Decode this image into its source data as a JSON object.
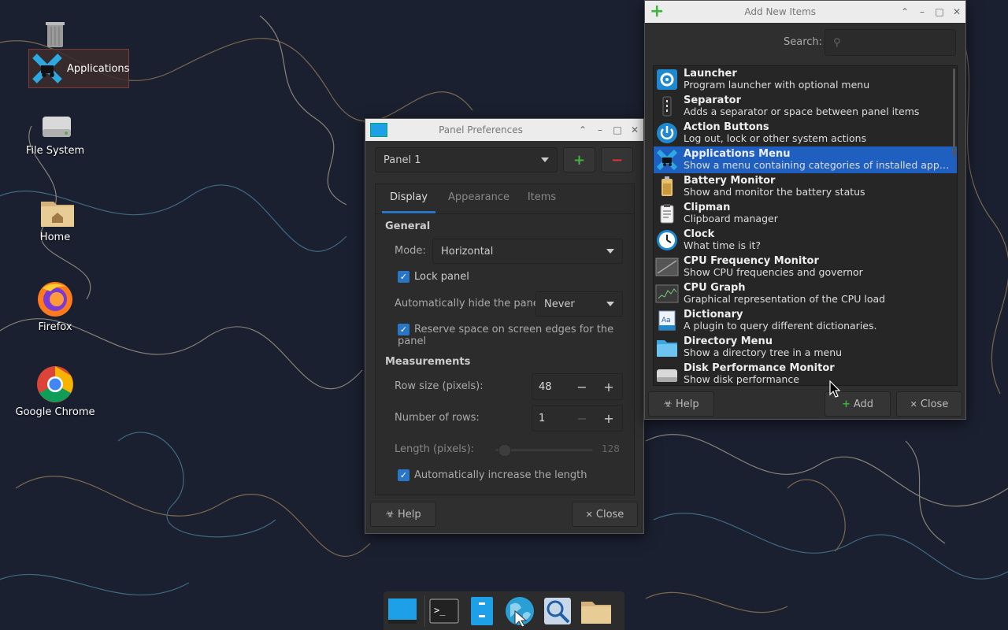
{
  "desktop": {
    "icons": [
      {
        "label": "",
        "icon": "trash-icon"
      },
      {
        "label": "Applications",
        "icon": "applications-icon"
      },
      {
        "label": "File System",
        "icon": "drive-icon"
      },
      {
        "label": "Home",
        "icon": "home-folder-icon"
      },
      {
        "label": "Firefox",
        "icon": "firefox-icon"
      },
      {
        "label": "Google Chrome",
        "icon": "chrome-icon"
      }
    ]
  },
  "panel_prefs": {
    "title": "Panel Preferences",
    "panel_select": "Panel 1",
    "add_label": "+",
    "remove_label": "−",
    "tabs": [
      "Display",
      "Appearance",
      "Items"
    ],
    "active_tab": "Display",
    "general_heading": "General",
    "mode_label": "Mode:",
    "mode_value": "Horizontal",
    "lock_panel": "Lock panel",
    "autohide_label": "Automatically hide the panel:",
    "autohide_value": "Never",
    "reserve_space": "Reserve space on screen edges for the panel",
    "measurements_heading": "Measurements",
    "row_size_label": "Row size (pixels):",
    "row_size_value": "48",
    "rows_label": "Number of rows:",
    "rows_value": "1",
    "length_label": "Length (pixels):",
    "length_value": "128",
    "auto_increase": "Automatically increase the length",
    "help": "Help",
    "close": "Close"
  },
  "add_items": {
    "title": "Add New Items",
    "search_label": "Search:",
    "search_placeholder": "",
    "items": [
      {
        "name": "Launcher",
        "desc": "Program launcher with optional menu",
        "icon": "gear-icon"
      },
      {
        "name": "Separator",
        "desc": "Adds a separator or space between panel items",
        "icon": "separator-icon"
      },
      {
        "name": "Action Buttons",
        "desc": "Log out, lock or other system actions",
        "icon": "power-icon"
      },
      {
        "name": "Applications Menu",
        "desc": "Show a menu containing categories of installed applications",
        "icon": "applications-menu-icon"
      },
      {
        "name": "Battery Monitor",
        "desc": "Show and monitor the battery status",
        "icon": "battery-icon"
      },
      {
        "name": "Clipman",
        "desc": "Clipboard manager",
        "icon": "clipboard-icon"
      },
      {
        "name": "Clock",
        "desc": "What time is it?",
        "icon": "clock-icon"
      },
      {
        "name": "CPU Frequency Monitor",
        "desc": "Show CPU frequencies and governor",
        "icon": "cpu-freq-icon"
      },
      {
        "name": "CPU Graph",
        "desc": "Graphical representation of the CPU load",
        "icon": "cpu-graph-icon"
      },
      {
        "name": "Dictionary",
        "desc": "A plugin to query different dictionaries.",
        "icon": "dictionary-icon"
      },
      {
        "name": "Directory Menu",
        "desc": "Show a directory tree in a menu",
        "icon": "folder-icon"
      },
      {
        "name": "Disk Performance Monitor",
        "desc": "Show disk performance",
        "icon": "disk-icon"
      }
    ],
    "selected_index": 3,
    "help": "Help",
    "add": "Add",
    "close": "Close"
  },
  "colors": {
    "accent": "#1f5fbf",
    "check": "#2a76c6",
    "add_green": "#3fb33f",
    "remove_red": "#d33"
  }
}
